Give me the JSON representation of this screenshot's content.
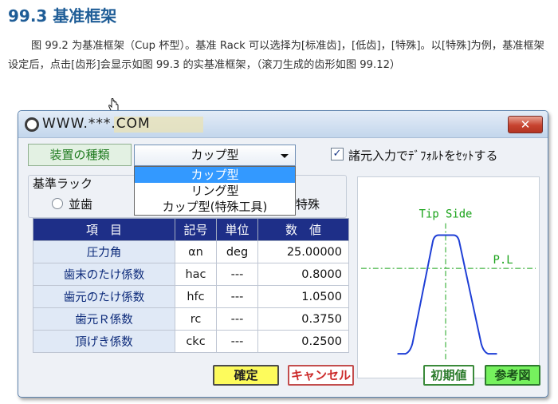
{
  "heading": "99.3 基准框架",
  "paragraph": "图 99.2 为基准框架（Cup 杯型）。基准 Rack 可以选择为[标准齿]，[低齿]，[特殊]。以[特殊]为例，基准框架设定后，点击[齿形]会显示如图 99.3 的实基准框架，（滚刀生成的齿形如图 99.12）",
  "window": {
    "watermark": "WWW.***.COM",
    "close_glyph": "✕"
  },
  "device": {
    "label": "装置の種類",
    "selected": "カップ型",
    "options": [
      "カップ型",
      "リング型",
      "カップ型(特殊工具)"
    ]
  },
  "default_checkbox": {
    "checked": true,
    "label": "諸元入力でﾃﾞﾌｫﾙﾄをｾｯﾄする"
  },
  "rack": {
    "title": "基準ラック",
    "options": [
      "並歯",
      "特殊"
    ]
  },
  "table": {
    "headers": [
      "項　目",
      "記号",
      "単位",
      "数　値"
    ],
    "rows": [
      {
        "name": "圧力角",
        "symbol": "αn",
        "unit": "deg",
        "value": "25.00000"
      },
      {
        "name": "歯末のたけ係数",
        "symbol": "hac",
        "unit": "---",
        "value": "0.8000"
      },
      {
        "name": "歯元のたけ係数",
        "symbol": "hfc",
        "unit": "---",
        "value": "1.0500"
      },
      {
        "name": "歯元Ｒ係数",
        "symbol": "rc",
        "unit": "---",
        "value": "0.3750"
      },
      {
        "name": "頂げき係数",
        "symbol": "ckc",
        "unit": "---",
        "value": "0.2500"
      }
    ]
  },
  "diagram": {
    "tip_label": "Tip Side",
    "pl_label": "P.L"
  },
  "buttons": {
    "ok": "確定",
    "cancel": "キャンセル",
    "init": "初期値",
    "reference": "参考図"
  },
  "colors": {
    "heading": "#1f5d97",
    "table_header": "#1e2f88",
    "diagram_curve": "#1f3fd6",
    "diagram_guides": "#1aa31a"
  }
}
